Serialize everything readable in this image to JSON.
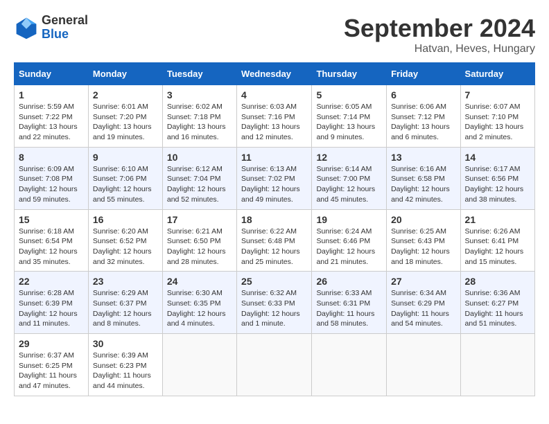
{
  "header": {
    "logo_general": "General",
    "logo_blue": "Blue",
    "title": "September 2024",
    "location": "Hatvan, Heves, Hungary"
  },
  "days_of_week": [
    "Sunday",
    "Monday",
    "Tuesday",
    "Wednesday",
    "Thursday",
    "Friday",
    "Saturday"
  ],
  "weeks": [
    [
      {
        "day": "1",
        "sunrise": "Sunrise: 5:59 AM",
        "sunset": "Sunset: 7:22 PM",
        "daylight": "Daylight: 13 hours and 22 minutes."
      },
      {
        "day": "2",
        "sunrise": "Sunrise: 6:01 AM",
        "sunset": "Sunset: 7:20 PM",
        "daylight": "Daylight: 13 hours and 19 minutes."
      },
      {
        "day": "3",
        "sunrise": "Sunrise: 6:02 AM",
        "sunset": "Sunset: 7:18 PM",
        "daylight": "Daylight: 13 hours and 16 minutes."
      },
      {
        "day": "4",
        "sunrise": "Sunrise: 6:03 AM",
        "sunset": "Sunset: 7:16 PM",
        "daylight": "Daylight: 13 hours and 12 minutes."
      },
      {
        "day": "5",
        "sunrise": "Sunrise: 6:05 AM",
        "sunset": "Sunset: 7:14 PM",
        "daylight": "Daylight: 13 hours and 9 minutes."
      },
      {
        "day": "6",
        "sunrise": "Sunrise: 6:06 AM",
        "sunset": "Sunset: 7:12 PM",
        "daylight": "Daylight: 13 hours and 6 minutes."
      },
      {
        "day": "7",
        "sunrise": "Sunrise: 6:07 AM",
        "sunset": "Sunset: 7:10 PM",
        "daylight": "Daylight: 13 hours and 2 minutes."
      }
    ],
    [
      {
        "day": "8",
        "sunrise": "Sunrise: 6:09 AM",
        "sunset": "Sunset: 7:08 PM",
        "daylight": "Daylight: 12 hours and 59 minutes."
      },
      {
        "day": "9",
        "sunrise": "Sunrise: 6:10 AM",
        "sunset": "Sunset: 7:06 PM",
        "daylight": "Daylight: 12 hours and 55 minutes."
      },
      {
        "day": "10",
        "sunrise": "Sunrise: 6:12 AM",
        "sunset": "Sunset: 7:04 PM",
        "daylight": "Daylight: 12 hours and 52 minutes."
      },
      {
        "day": "11",
        "sunrise": "Sunrise: 6:13 AM",
        "sunset": "Sunset: 7:02 PM",
        "daylight": "Daylight: 12 hours and 49 minutes."
      },
      {
        "day": "12",
        "sunrise": "Sunrise: 6:14 AM",
        "sunset": "Sunset: 7:00 PM",
        "daylight": "Daylight: 12 hours and 45 minutes."
      },
      {
        "day": "13",
        "sunrise": "Sunrise: 6:16 AM",
        "sunset": "Sunset: 6:58 PM",
        "daylight": "Daylight: 12 hours and 42 minutes."
      },
      {
        "day": "14",
        "sunrise": "Sunrise: 6:17 AM",
        "sunset": "Sunset: 6:56 PM",
        "daylight": "Daylight: 12 hours and 38 minutes."
      }
    ],
    [
      {
        "day": "15",
        "sunrise": "Sunrise: 6:18 AM",
        "sunset": "Sunset: 6:54 PM",
        "daylight": "Daylight: 12 hours and 35 minutes."
      },
      {
        "day": "16",
        "sunrise": "Sunrise: 6:20 AM",
        "sunset": "Sunset: 6:52 PM",
        "daylight": "Daylight: 12 hours and 32 minutes."
      },
      {
        "day": "17",
        "sunrise": "Sunrise: 6:21 AM",
        "sunset": "Sunset: 6:50 PM",
        "daylight": "Daylight: 12 hours and 28 minutes."
      },
      {
        "day": "18",
        "sunrise": "Sunrise: 6:22 AM",
        "sunset": "Sunset: 6:48 PM",
        "daylight": "Daylight: 12 hours and 25 minutes."
      },
      {
        "day": "19",
        "sunrise": "Sunrise: 6:24 AM",
        "sunset": "Sunset: 6:46 PM",
        "daylight": "Daylight: 12 hours and 21 minutes."
      },
      {
        "day": "20",
        "sunrise": "Sunrise: 6:25 AM",
        "sunset": "Sunset: 6:43 PM",
        "daylight": "Daylight: 12 hours and 18 minutes."
      },
      {
        "day": "21",
        "sunrise": "Sunrise: 6:26 AM",
        "sunset": "Sunset: 6:41 PM",
        "daylight": "Daylight: 12 hours and 15 minutes."
      }
    ],
    [
      {
        "day": "22",
        "sunrise": "Sunrise: 6:28 AM",
        "sunset": "Sunset: 6:39 PM",
        "daylight": "Daylight: 12 hours and 11 minutes."
      },
      {
        "day": "23",
        "sunrise": "Sunrise: 6:29 AM",
        "sunset": "Sunset: 6:37 PM",
        "daylight": "Daylight: 12 hours and 8 minutes."
      },
      {
        "day": "24",
        "sunrise": "Sunrise: 6:30 AM",
        "sunset": "Sunset: 6:35 PM",
        "daylight": "Daylight: 12 hours and 4 minutes."
      },
      {
        "day": "25",
        "sunrise": "Sunrise: 6:32 AM",
        "sunset": "Sunset: 6:33 PM",
        "daylight": "Daylight: 12 hours and 1 minute."
      },
      {
        "day": "26",
        "sunrise": "Sunrise: 6:33 AM",
        "sunset": "Sunset: 6:31 PM",
        "daylight": "Daylight: 11 hours and 58 minutes."
      },
      {
        "day": "27",
        "sunrise": "Sunrise: 6:34 AM",
        "sunset": "Sunset: 6:29 PM",
        "daylight": "Daylight: 11 hours and 54 minutes."
      },
      {
        "day": "28",
        "sunrise": "Sunrise: 6:36 AM",
        "sunset": "Sunset: 6:27 PM",
        "daylight": "Daylight: 11 hours and 51 minutes."
      }
    ],
    [
      {
        "day": "29",
        "sunrise": "Sunrise: 6:37 AM",
        "sunset": "Sunset: 6:25 PM",
        "daylight": "Daylight: 11 hours and 47 minutes."
      },
      {
        "day": "30",
        "sunrise": "Sunrise: 6:39 AM",
        "sunset": "Sunset: 6:23 PM",
        "daylight": "Daylight: 11 hours and 44 minutes."
      },
      null,
      null,
      null,
      null,
      null
    ]
  ]
}
